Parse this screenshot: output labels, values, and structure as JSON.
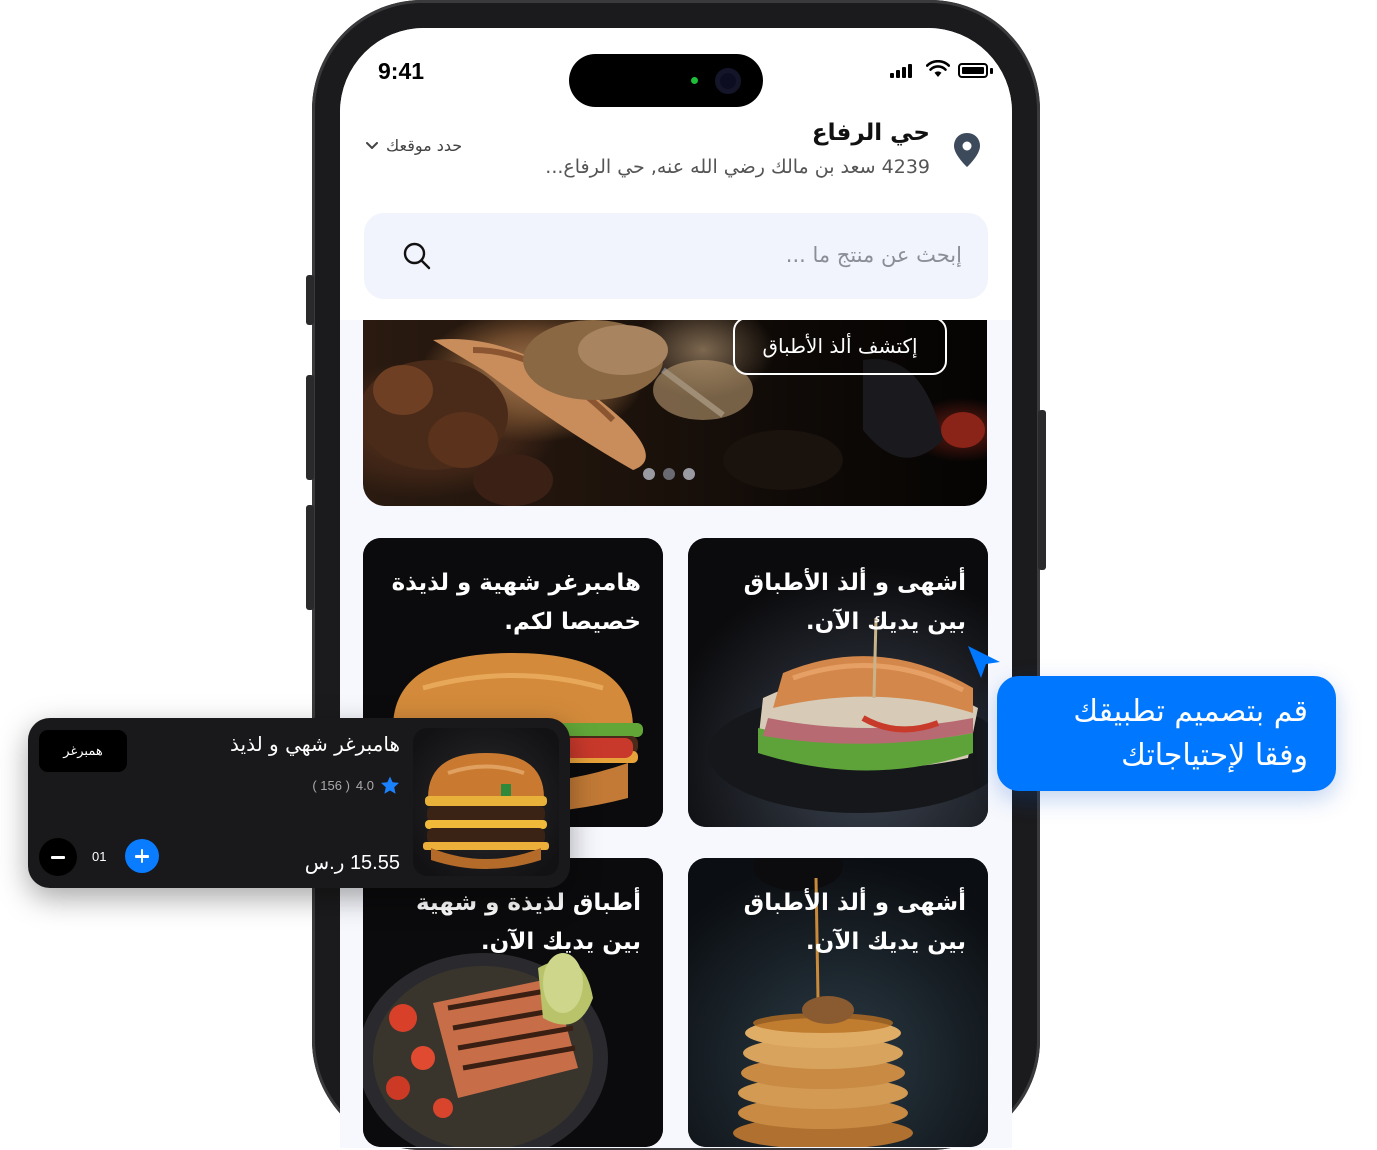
{
  "status_bar": {
    "time": "9:41"
  },
  "location": {
    "title": "حي الرفاع",
    "address": "4239 سعد بن مالك رضي الله عنه, حي الرفاع...",
    "select_label": "حدد موقعك"
  },
  "search": {
    "placeholder": "إبحث عن منتج ما ..."
  },
  "banner": {
    "button_label": "إكتشف ألذ الأطباق",
    "slide_count": 3,
    "active_slide": 1
  },
  "cards": [
    {
      "line1": "أشهى و ألذ الأطباق",
      "line2": "بين يديك الآن."
    },
    {
      "line1": "هامبرغر شهية و لذيذة",
      "line2": "خصيصا لكم."
    },
    {
      "line1": "أشهى و ألذ الأطباق",
      "line2": "بين يديك الآن."
    },
    {
      "line1": "أطباق لذيذة و شهية",
      "line2": "بين يديك الآن."
    }
  ],
  "callout": {
    "line1": "قم بتصميم تطبيقك",
    "line2": "وفقا لإحتياجاتك"
  },
  "product": {
    "name": "هامبرغر شهي و لذيذ",
    "rating": "4.0",
    "reviews": "( 156 )",
    "price": "15.55 ر.س",
    "tag": "همبرغر",
    "quantity": "01"
  },
  "colors": {
    "accent": "#0077ff",
    "card_bg": "#19191b",
    "screen_bg": "#f6f8fd"
  }
}
